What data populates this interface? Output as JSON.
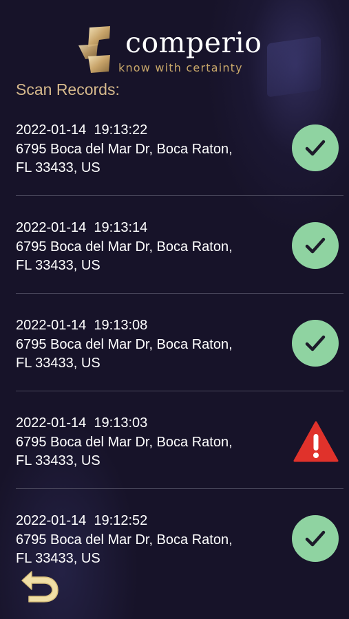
{
  "brand": {
    "name": "comperio",
    "tagline": "know with certainty"
  },
  "section_title": "Scan Records:",
  "records": [
    {
      "datetime": "2022-01-14  19:13:22",
      "address_line1": "6795 Boca del Mar Dr, Boca Raton,",
      "address_line2": "FL 33433, US",
      "status": "check-icon"
    },
    {
      "datetime": "2022-01-14  19:13:14",
      "address_line1": "6795 Boca del Mar Dr, Boca Raton,",
      "address_line2": "FL 33433, US",
      "status": "check-icon"
    },
    {
      "datetime": "2022-01-14  19:13:08",
      "address_line1": "6795 Boca del Mar Dr, Boca Raton,",
      "address_line2": "FL 33433, US",
      "status": "check-icon"
    },
    {
      "datetime": "2022-01-14  19:13:03",
      "address_line1": "6795 Boca del Mar Dr, Boca Raton,",
      "address_line2": "FL 33433, US",
      "status": "warning-icon"
    },
    {
      "datetime": "2022-01-14  19:12:52",
      "address_line1": "6795 Boca del Mar Dr, Boca Raton,",
      "address_line2": "FL 33433, US",
      "status": "check-icon"
    }
  ],
  "colors": {
    "background": "#171329",
    "accent_gold": "#c9a86a",
    "ok_green": "#8fd3a1",
    "warning_red": "#e0322b"
  },
  "icons": {
    "back": "back-arrow-icon"
  }
}
